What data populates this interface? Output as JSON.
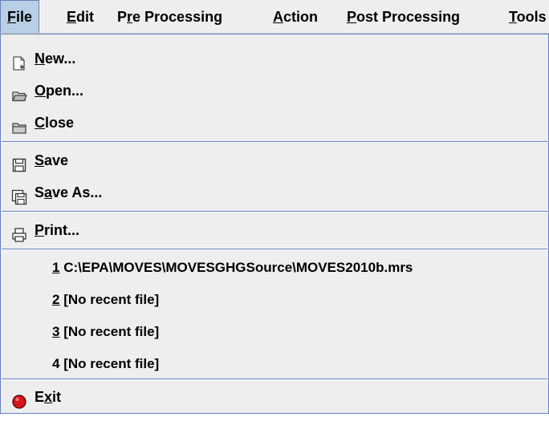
{
  "menubar": {
    "items": [
      {
        "id": "file",
        "pre": "",
        "u": "F",
        "post": "ile"
      },
      {
        "id": "edit",
        "pre": "",
        "u": "E",
        "post": "dit"
      },
      {
        "id": "preprocessing",
        "pre": "P",
        "u": "r",
        "post": "e Processing"
      },
      {
        "id": "action",
        "pre": "",
        "u": "A",
        "post": "ction"
      },
      {
        "id": "postprocessing",
        "pre": "",
        "u": "P",
        "post": "ost Processing"
      },
      {
        "id": "tools",
        "pre": "",
        "u": "T",
        "post": "ools"
      }
    ]
  },
  "file_menu": {
    "new": {
      "pre": "",
      "u": "N",
      "post": "ew..."
    },
    "open": {
      "pre": "",
      "u": "O",
      "post": "pen..."
    },
    "close": {
      "pre": "",
      "u": "C",
      "post": "lose"
    },
    "save": {
      "pre": "",
      "u": "S",
      "post": "ave"
    },
    "save_as": {
      "pre": "S",
      "u": "a",
      "post": "ve As..."
    },
    "print": {
      "pre": "",
      "u": "P",
      "post": "rint..."
    },
    "recent": [
      {
        "num": "1",
        "text": " C:\\EPA\\MOVES\\MOVESGHGSource\\MOVES2010b.mrs"
      },
      {
        "num": "2",
        "text": " [No recent file]"
      },
      {
        "num": "3",
        "text": " [No recent file]"
      },
      {
        "num": "4",
        "text": " [No recent file]"
      }
    ],
    "exit": {
      "pre": "E",
      "u": "x",
      "post": "it"
    }
  }
}
